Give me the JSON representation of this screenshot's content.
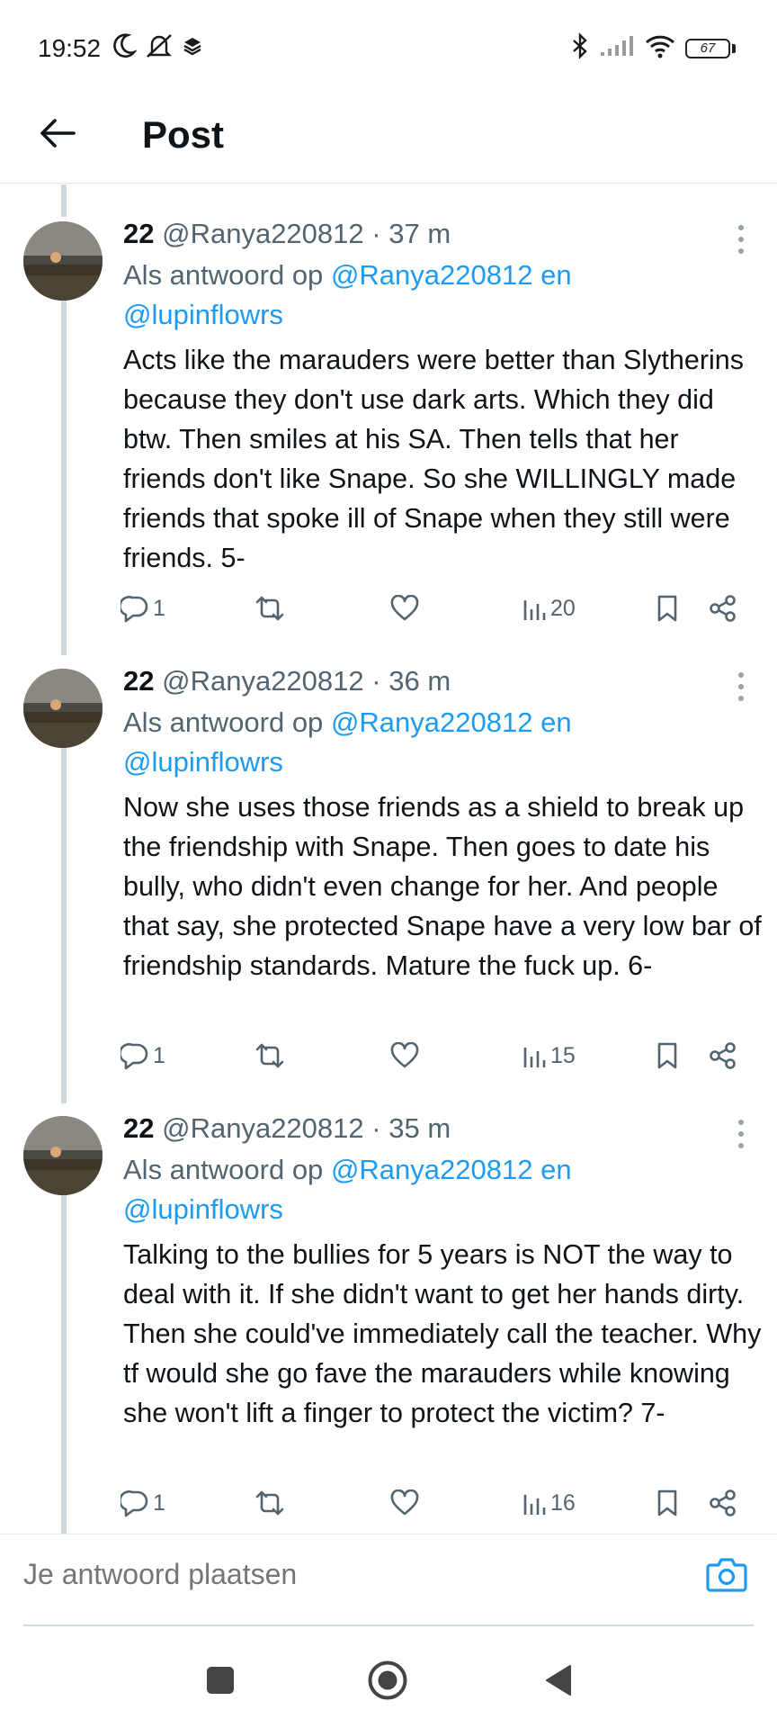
{
  "status_bar": {
    "time": "19:52",
    "battery": "67",
    "icons": [
      "moon-icon",
      "mute-icon",
      "layers-icon",
      "bluetooth-icon",
      "signal-icon",
      "wifi-icon",
      "battery-icon"
    ]
  },
  "header": {
    "title": "Post",
    "back_icon": "arrow-left-icon"
  },
  "tweets": [
    {
      "name": "22",
      "handle": "@Ranya220812",
      "dot": "·",
      "time": "37 m",
      "reply_prefix": "Als antwoord op",
      "reply_handles": "@Ranya220812 en",
      "reply_handles_2": "@lupinflowrs",
      "text": "Acts like the marauders were better than Slytherins because they don't use dark arts. Which they did btw. Then smiles at his SA. Then tells that her friends don't like Snape. So she WILLINGLY made friends that spoke ill of Snape when they still were friends. 5-",
      "replies": "1",
      "views": "20"
    },
    {
      "name": "22",
      "handle": "@Ranya220812",
      "dot": "·",
      "time": "36 m",
      "reply_prefix": "Als antwoord op",
      "reply_handles": "@Ranya220812 en",
      "reply_handles_2": "@lupinflowrs",
      "text": "Now she uses those friends as a shield to break up the friendship with Snape. Then goes to date his bully, who didn't even change for her. And people that say, she protected Snape have a very low bar of friendship standards. Mature the fuck up. 6-",
      "replies": "1",
      "views": "15"
    },
    {
      "name": "22",
      "handle": "@Ranya220812",
      "dot": "·",
      "time": "35 m",
      "reply_prefix": "Als antwoord op",
      "reply_handles": "@Ranya220812 en",
      "reply_handles_2": "@lupinflowrs",
      "text": "Talking to the bullies for 5 years is NOT the way to deal with it. If she didn't want to get her hands dirty. Then she could've immediately call the teacher. Why tf would she go fave the marauders while knowing she won't lift a finger to protect the victim? 7-",
      "replies": "1",
      "views": "16"
    }
  ],
  "reply_bar": {
    "placeholder": "Je antwoord plaatsen",
    "camera_icon": "camera-icon"
  },
  "nav_bar": {
    "icons": [
      "recents-square-icon",
      "home-circle-icon",
      "back-triangle-icon"
    ]
  },
  "colors": {
    "link": "#1d9bf0",
    "secondary_text": "#536471",
    "thread_line": "#cfd9de"
  }
}
